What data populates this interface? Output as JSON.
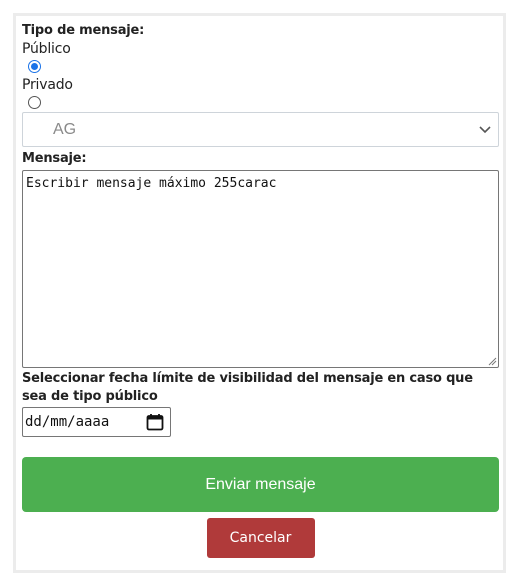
{
  "form": {
    "message_type_label": "Tipo de mensaje:",
    "options": [
      {
        "label": "Público",
        "checked": true
      },
      {
        "label": "Privado",
        "checked": false
      }
    ],
    "select": {
      "value": "AG",
      "icon": "chevron-down-icon"
    },
    "message_label": "Mensaje:",
    "message_value": "Escribir mensaje máximo 255carac",
    "date_label": "Seleccionar fecha límite de visibilidad del mensaje en caso que sea de tipo público",
    "date_placeholder": "dd/mm/aaaa",
    "submit_label": "Enviar mensaje",
    "cancel_label": "Cancelar"
  },
  "colors": {
    "submit": "#4caf50",
    "cancel": "#b03a3a",
    "radio_accent": "#1a73e8"
  }
}
